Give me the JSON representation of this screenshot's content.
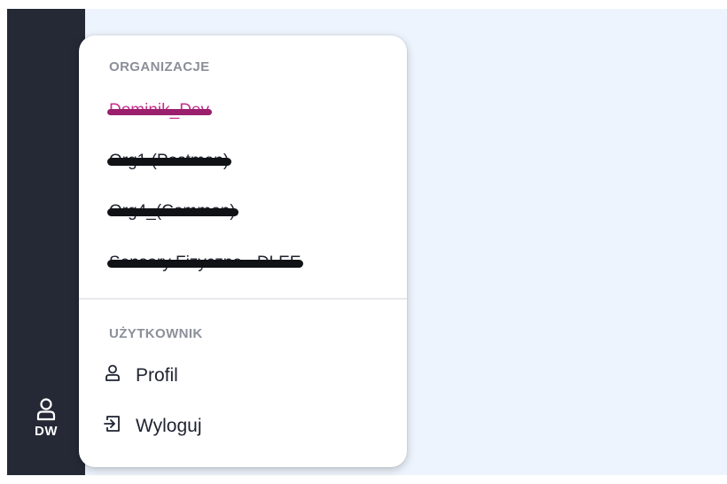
{
  "user": {
    "initials": "DW",
    "icon": "user-icon"
  },
  "menu": {
    "organizations_title": "ORGANIZACJE",
    "organizations": [
      {
        "label": "Dominik_Dev",
        "active": true,
        "redacted": true
      },
      {
        "label": "Org1 (Postman)",
        "active": false,
        "redacted": true
      },
      {
        "label": "Org4_(Common)",
        "active": false,
        "redacted": true
      },
      {
        "label": "Sensory Fizyczne - DLEE",
        "active": false,
        "redacted": true
      }
    ],
    "user_title": "UŻYTKOWNIK",
    "profile_label": "Profil",
    "profile_icon": "user-icon",
    "logout_label": "Wyloguj",
    "logout_icon": "logout-icon"
  },
  "colors": {
    "sidebar": "#252936",
    "main_background": "#eef4fd",
    "active_org": "#c6308e"
  }
}
